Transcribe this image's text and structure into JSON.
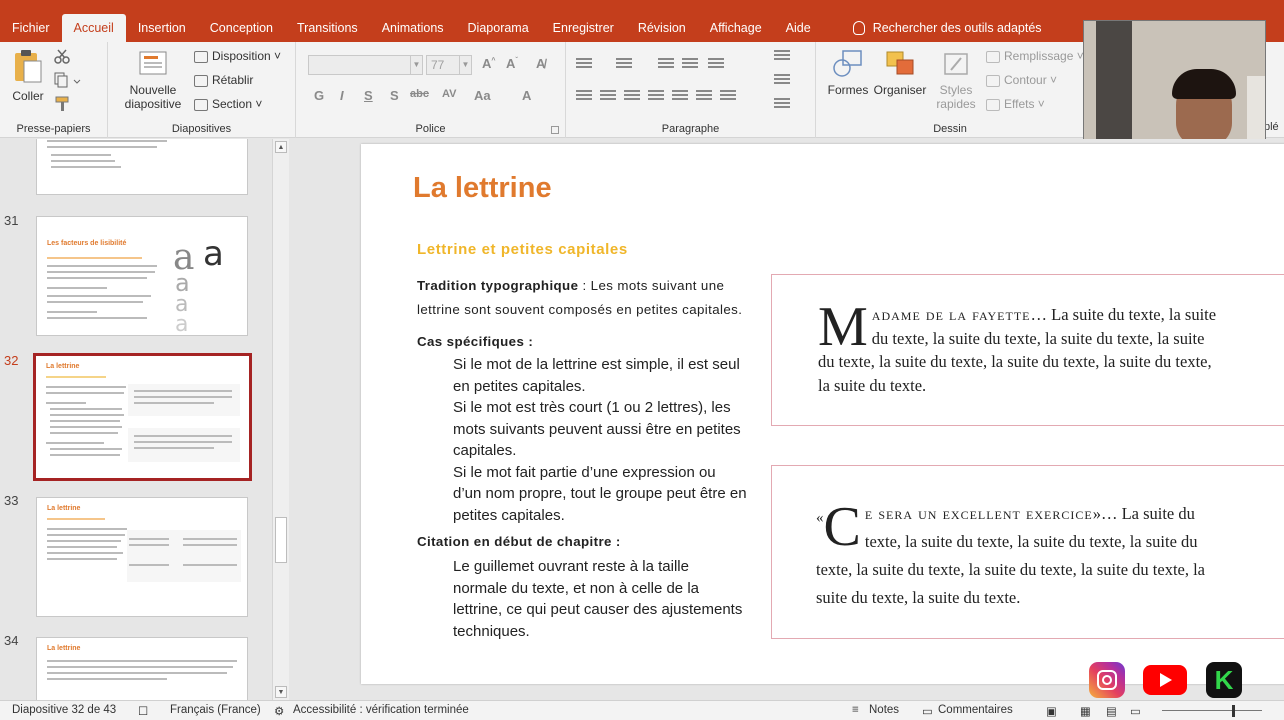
{
  "ribbon_tabs": [
    "Fichier",
    "Accueil",
    "Insertion",
    "Conception",
    "Transitions",
    "Animations",
    "Diaporama",
    "Enregistrer",
    "Révision",
    "Affichage",
    "Aide"
  ],
  "active_tab": "Accueil",
  "tell_me": "Rechercher des outils adaptés",
  "ribbon": {
    "clipboard": {
      "paste": "Coller",
      "label": "Presse-papiers"
    },
    "slides": {
      "new_slide_line1": "Nouvelle",
      "new_slide_line2": "diapositive",
      "layout": "Disposition",
      "reset": "Rétablir",
      "section": "Section",
      "label": "Diapositives"
    },
    "font": {
      "font_size": "77",
      "bold": "G",
      "italic": "I",
      "underline": "S",
      "shadow": "S",
      "strike": "abc",
      "spacing": "AV",
      "case": "Aa",
      "color": "A",
      "label": "Police"
    },
    "paragraph": {
      "label": "Paragraphe"
    },
    "drawing": {
      "shapes": "Formes",
      "arrange": "Organiser",
      "quick_styles_line1": "Styles",
      "quick_styles_line2": "rapides",
      "fill": "Remplissage",
      "outline": "Contour",
      "effects": "Effets",
      "label": "Dessin"
    },
    "overflow_label": "plé"
  },
  "thumbnails": [
    {
      "number": "",
      "title": ""
    },
    {
      "number": "31",
      "title": "Les facteurs de lisibilité"
    },
    {
      "number": "32",
      "title": "La lettrine",
      "active": true
    },
    {
      "number": "33",
      "title": "La lettrine"
    },
    {
      "number": "34",
      "title": "La lettrine"
    }
  ],
  "slide": {
    "title": "La lettrine",
    "subtitle": "Lettrine et petites capitales",
    "tradition_heading": "Tradition typographique",
    "tradition_text": " : Les mots suivant une lettrine sont souvent composés en petites capitales.",
    "specific_heading": "Cas spécifiques :",
    "specific_items": [
      "Si le mot de la lettrine est simple, il est seul en petites capitales.",
      "Si le mot est très court (1 ou 2 lettres), les mots suivants peuvent aussi être en petites capitales.",
      "Si le mot fait partie d’une expression ou d’un nom propre, tout le groupe peut être en petites capitales."
    ],
    "citation_heading": "Citation en début de chapitre :",
    "citation_text": "Le guillemet ouvrant reste à la taille normale du texte, et non à celle de la lettrine, ce qui peut causer des ajustements techniques.",
    "example1": {
      "dropcap": "M",
      "smallcaps": "adame de la fayette",
      "text": "… La suite du texte, la suite du texte, la suite du texte, la suite du texte, la suite du texte, la suite du texte, la suite du texte, la suite du texte, la suite du texte."
    },
    "example2": {
      "open_quote": "«",
      "dropcap": "C",
      "smallcaps": "e sera un excellent exercice",
      "close_quote": "»",
      "text": "… La suite du texte, la suite du texte, la suite du texte, la suite du texte, la suite du texte, la suite du texte, la suite du texte, la suite du texte, la suite du texte."
    }
  },
  "status": {
    "slide_position": "Diapositive 32 de 43",
    "language": "Français (France)",
    "accessibility": "Accessibilité : vérification terminée",
    "notes": "Notes",
    "comments": "Commentaires"
  },
  "colors": {
    "accent": "#c43e1c",
    "slide_title": "#e07a2e",
    "slide_subtitle": "#f0b62a",
    "box_border": "#e3a9b2",
    "active_thumb": "#a52323"
  }
}
